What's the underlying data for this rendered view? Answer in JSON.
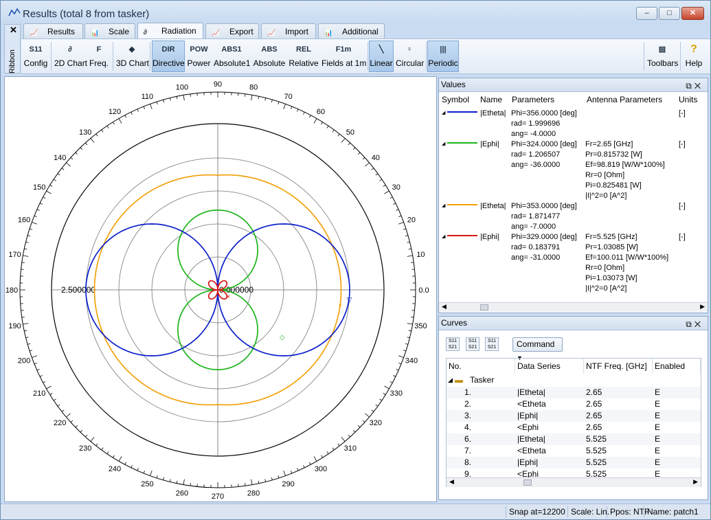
{
  "window": {
    "title": "Results (total 8 from tasker)",
    "controls": [
      "–",
      "□",
      "✕"
    ]
  },
  "ribbon": {
    "close": "✕",
    "label": "Ribbon"
  },
  "tabs": [
    "Results",
    "Scale",
    "Radiation",
    "Export",
    "Import",
    "Additional"
  ],
  "toolbar": [
    {
      "icon": "S11",
      "label": "Config"
    },
    {
      "icon": "∂",
      "label": "2D Chart"
    },
    {
      "icon": "F",
      "label": "Freq."
    },
    {
      "icon": "◆",
      "label": "3D Chart"
    },
    {
      "icon": "DIR",
      "label": "Directive"
    },
    {
      "icon": "POW",
      "label": "Power"
    },
    {
      "icon": "ABS1",
      "label": "Absolute1"
    },
    {
      "icon": "ABS",
      "label": "Absolute"
    },
    {
      "icon": "REL",
      "label": "Relative"
    },
    {
      "icon": "F1m",
      "label": "Fields at 1m"
    },
    {
      "icon": "╲",
      "label": "Linear"
    },
    {
      "icon": "♀",
      "label": "Circular"
    },
    {
      "icon": "|||",
      "label": "Periodic"
    },
    {
      "icon": "▤",
      "label": "Toolbars"
    },
    {
      "icon": "?",
      "label": "Help"
    }
  ],
  "chart_data": {
    "type": "polar",
    "angle_labels": [
      "0.0",
      "10",
      "20",
      "30",
      "40",
      "50",
      "60",
      "70",
      "80",
      "90",
      "100",
      "110",
      "120",
      "130",
      "140",
      "150",
      "160",
      "170",
      "180",
      "190",
      "200",
      "210",
      "220",
      "230",
      "240",
      "250",
      "260",
      "270",
      "280",
      "290",
      "300",
      "310",
      "320",
      "330",
      "340",
      "350"
    ],
    "radius_labels": {
      "outer": "2.500000",
      "center": "0.000000"
    },
    "rlim": [
      0,
      2.5
    ],
    "series": [
      {
        "color": "#0b1fc9",
        "shape": "two-lobe horizontal (|cos phi|)",
        "peak": 2.0
      },
      {
        "color": "#1cb51c",
        "shape": "two-lobe vertical (|sin phi|)",
        "peak": 1.21
      },
      {
        "color": "#f2a20c",
        "shape": "near-circle",
        "peak": 1.87
      },
      {
        "color": "#d61515",
        "shape": "small four-lobe",
        "peak": 0.18
      }
    ]
  },
  "values_pane": {
    "title": "Values",
    "columns": [
      "Symbol",
      "Name",
      "Parameters",
      "Antenna Parameters",
      "Units"
    ],
    "rows": [
      {
        "color": "#0b1fc9",
        "name": "|Etheta|",
        "params": "Phi=356.0000 [deg]\nrad= 1.999696\nang= -4.0000",
        "antenna": "",
        "units": "[-]"
      },
      {
        "color": "#1cb51c",
        "name": "|Ephi|",
        "params": "Phi=324.0000 [deg]\nrad= 1.206507\nang= -36.0000",
        "antenna": "Fr=2.65 [GHz]\nPr=0.815732 [W]\nEf=98.819 [W/W*100%]\nRr=0 [Ohm]\nPi=0.825481 [W]\n|I|^2=0 [A^2]",
        "units": "[-]"
      },
      {
        "color": "#f2a20c",
        "name": "|Etheta|",
        "params": "Phi=353.0000 [deg]\nrad= 1.871477\nang= -7.0000",
        "antenna": "",
        "units": "[-]"
      },
      {
        "color": "#d61515",
        "name": "|Ephi|",
        "params": "Phi=329.0000 [deg]\nrad= 0.183791\nang= -31.0000",
        "antenna": "Fr=5.525 [GHz]\nPr=1.03085 [W]\nEf=100.011 [W/W*100%]\nRr=0 [Ohm]\nPi=1.03073 [W]\n|I|^2=0 [A^2]",
        "units": "[-]"
      }
    ]
  },
  "curves_pane": {
    "title": "Curves",
    "tools": [
      "S11 S21",
      "S11 S21",
      "S11 S21"
    ],
    "command": "Command",
    "columns": [
      "No.",
      "Data Series",
      "NTF Freq. [GHz]",
      "Enabled"
    ],
    "group": "Tasker",
    "rows": [
      {
        "no": "1.",
        "series": "|Etheta|",
        "freq": "2.65",
        "enabled": "E"
      },
      {
        "no": "2.",
        "series": "<Etheta",
        "freq": "2.65",
        "enabled": "E"
      },
      {
        "no": "3.",
        "series": "|Ephi|",
        "freq": "2.65",
        "enabled": "E"
      },
      {
        "no": "4.",
        "series": "<Ephi",
        "freq": "2.65",
        "enabled": "E"
      },
      {
        "no": "6.",
        "series": "|Etheta|",
        "freq": "5.525",
        "enabled": "E"
      },
      {
        "no": "7.",
        "series": "<Etheta",
        "freq": "5.525",
        "enabled": "E"
      },
      {
        "no": "8.",
        "series": "|Ephi|",
        "freq": "5.525",
        "enabled": "E"
      },
      {
        "no": "9.",
        "series": "<Ephi",
        "freq": "5.525",
        "enabled": "E"
      }
    ]
  },
  "status": {
    "snap": "Snap at=12200",
    "scale": "Scale: Lin.",
    "ppos": "Ppos: NTF",
    "name": "Name: patch1"
  }
}
